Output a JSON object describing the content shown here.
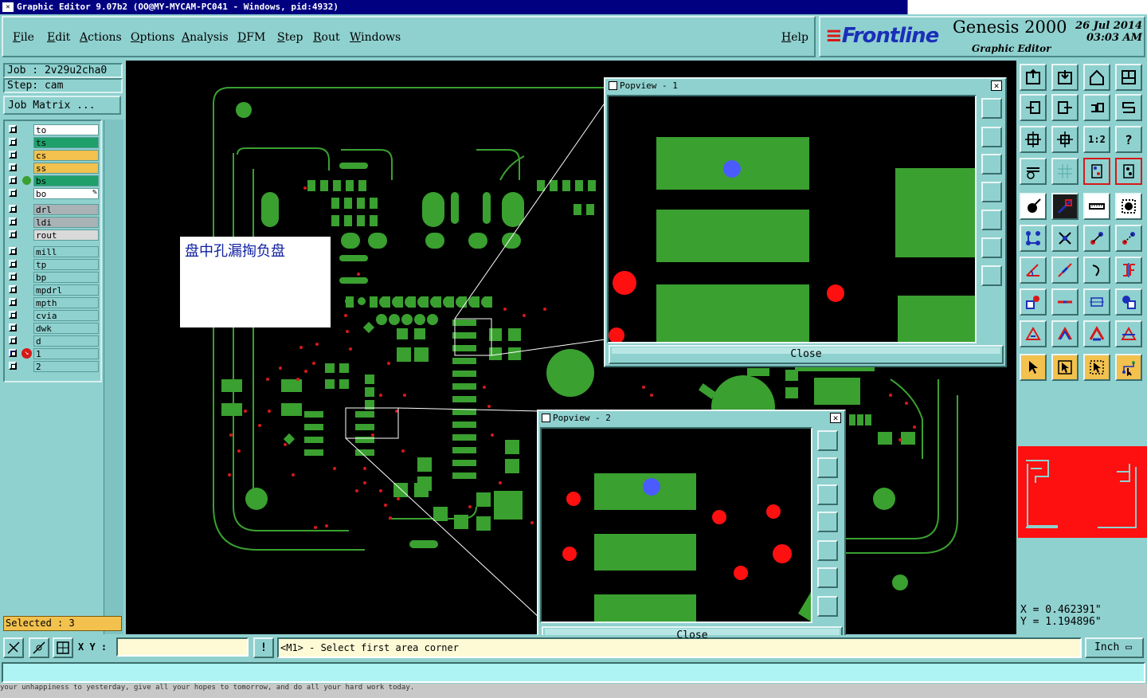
{
  "window": {
    "title": "Graphic Editor 9.07b2  (OO@MY-MYCAM-PC041 - Windows, pid:4932)"
  },
  "menu": {
    "items": [
      "File",
      "Edit",
      "Actions",
      "Options",
      "Analysis",
      "DFM",
      "Step",
      "Rout",
      "Windows"
    ],
    "help": "Help"
  },
  "brand": {
    "logo": "Frontline",
    "product": "Genesis 2000",
    "subtitle": "Graphic Editor",
    "date": "26 Jul 2014",
    "time": "03:03 AM"
  },
  "job": {
    "job_line": "Job : 2v29u2cha0",
    "step_line": "Step: cam",
    "job_matrix": "Job Matrix ..."
  },
  "layers": [
    {
      "name": "to",
      "color": "#ffffff"
    },
    {
      "name": "ts",
      "color": "#1fa06a"
    },
    {
      "name": "cs",
      "color": "#f2c14e"
    },
    {
      "name": "ss",
      "color": "#f2c14e"
    },
    {
      "name": "bs",
      "color": "#1fa06a"
    },
    {
      "name": "bo",
      "color": "#ffffff"
    },
    {
      "name": "drl",
      "color": "#a9b3b6"
    },
    {
      "name": "ldi",
      "color": "#a9b3b6"
    },
    {
      "name": "rout",
      "color": "#d9d9d9"
    },
    {
      "name": "mill",
      "color": "#8fd1cf"
    },
    {
      "name": "tp",
      "color": "#8fd1cf"
    },
    {
      "name": "bp",
      "color": "#8fd1cf"
    },
    {
      "name": "mpdrl",
      "color": "#8fd1cf"
    },
    {
      "name": "mpth",
      "color": "#8fd1cf"
    },
    {
      "name": "cvia",
      "color": "#8fd1cf"
    },
    {
      "name": "dwk",
      "color": "#8fd1cf"
    },
    {
      "name": "d",
      "color": "#8fd1cf"
    },
    {
      "name": "1",
      "color": "#8fd1cf"
    },
    {
      "name": "2",
      "color": "#8fd1cf"
    }
  ],
  "selected": "Selected : 3",
  "note": {
    "text": "盘中孔漏掏负盘"
  },
  "popview1": {
    "title": "Popview - 1",
    "close": "Close"
  },
  "popview2": {
    "title": "Popview - 2",
    "close": "Close"
  },
  "coords": {
    "x": "X  =  0.462391\"",
    "y": "Y  =  1.194896\""
  },
  "bottom": {
    "xy_label": "X Y :",
    "xy_value": "",
    "prompt": "<M1> - Select first area corner",
    "units": "Inch"
  },
  "taskbar": {
    "text": "        your unhappiness to yesterday, give all your hopes to tomorrow, and do all your hard work today."
  },
  "icons": [
    "zoom-home-icon",
    "pan-icon",
    "measure-icon",
    "select-icon",
    "snap-icon",
    "grid-icon"
  ]
}
